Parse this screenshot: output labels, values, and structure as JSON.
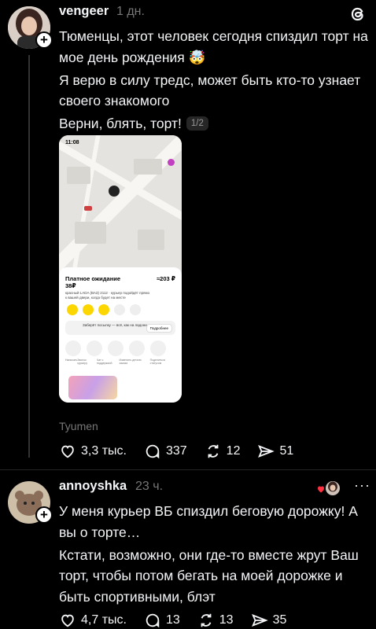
{
  "colors": {
    "background": "#000000",
    "text": "#f3f5f7",
    "muted": "#777777",
    "accent_heart": "#ff3040"
  },
  "app": {
    "logo_icon": "threads-logo-icon"
  },
  "post1": {
    "username": "vengeer",
    "time": "1 дн.",
    "paragraphs": [
      "Тюменцы, этот человек сегодня спиздил торт на мое день рождения 🤯",
      "Я верю в силу тредс, может быть кто-то узнает своего знакомого",
      "Верни, блять, торт!"
    ],
    "media_counter": "1/2",
    "screenshot": {
      "status_time": "11:08",
      "sheet_title": "Платное ожидание 38₽",
      "sheet_price": "≈203 ₽",
      "sheet_sub": "красный LADA (ВАЗ) 2112 · курьер подойдёт прямо к вашей двери, когда будет на месте",
      "pickup_text": "Заберёт посылку — всё, как на ладони",
      "pickup_button": "Подробнее",
      "circle_labels": [
        "Написать",
        "Звонок курьеру",
        "Чат с поддержкой",
        "Изменить детали заказа",
        "Поделиться статусом"
      ]
    },
    "location": "Tyumen",
    "likes": "3,3 тыс.",
    "comments": "337",
    "reposts": "12",
    "shares": "51"
  },
  "post2": {
    "username": "annoyshka",
    "time": "23 ч.",
    "paragraphs": [
      "У меня курьер ВБ спиздил беговую дорожку! А вы о торте…",
      "Кстати, возможно, они где-то вместе жрут Ваш торт, чтобы потом бегать на моей дорожке и быть спортивными, блэт"
    ],
    "likes": "4,7 тыс.",
    "comments": "13",
    "reposts": "13",
    "shares": "35"
  }
}
